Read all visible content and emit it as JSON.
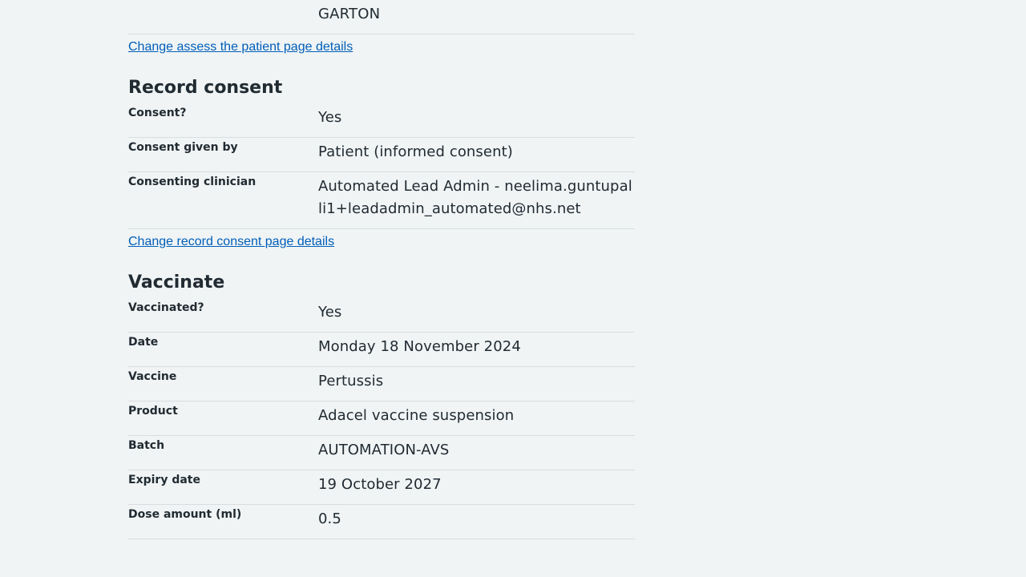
{
  "top_fragment": {
    "value": "GARTON",
    "change_link": "Change assess the patient page details"
  },
  "record_consent": {
    "heading": "Record consent",
    "rows": [
      {
        "key": "Consent?",
        "value": "Yes"
      },
      {
        "key": "Consent given by",
        "value": "Patient (informed consent)"
      },
      {
        "key": "Consenting clinician",
        "value": "Automated Lead Admin - neelima.guntupalli1+leadadmin_automated@nhs.net"
      }
    ],
    "change_link": "Change record consent page details"
  },
  "vaccinate": {
    "heading": "Vaccinate",
    "rows": [
      {
        "key": "Vaccinated?",
        "value": "Yes"
      },
      {
        "key": "Date",
        "value": "Monday 18 November 2024"
      },
      {
        "key": "Vaccine",
        "value": "Pertussis"
      },
      {
        "key": "Product",
        "value": "Adacel vaccine suspension"
      },
      {
        "key": "Batch",
        "value": "AUTOMATION-AVS"
      },
      {
        "key": "Expiry date",
        "value": "19 October 2027"
      },
      {
        "key": "Dose amount (ml)",
        "value": "0.5"
      }
    ]
  },
  "colors": {
    "background": "#f0f4f5",
    "text": "#212b32",
    "link": "#005eb8",
    "divider": "#d8dde0"
  }
}
